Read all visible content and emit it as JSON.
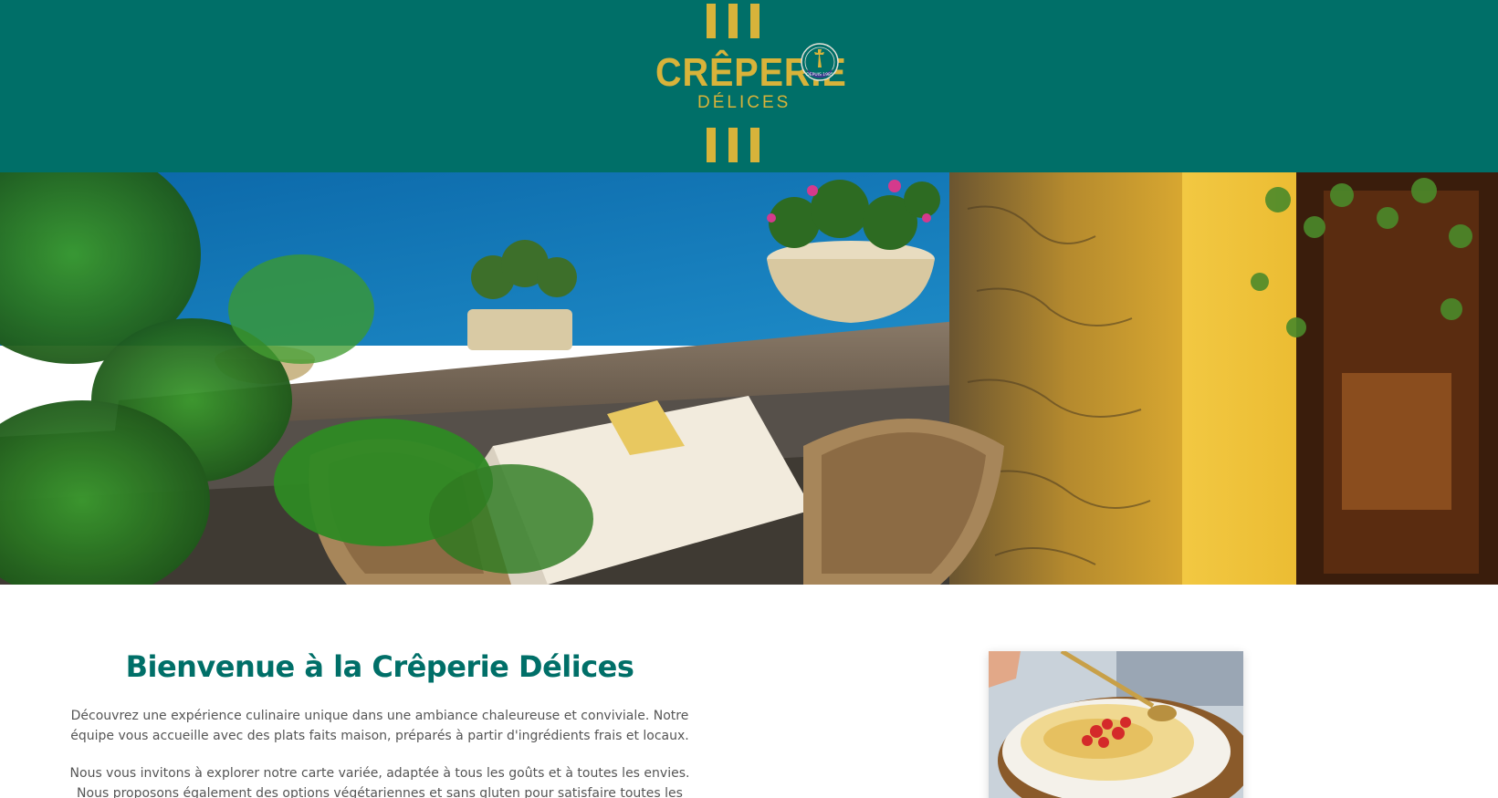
{
  "header": {
    "logo": {
      "word": "CRÊPERIE",
      "subtitle": "DÉLICES",
      "badge_text": "DEPUIS 1985"
    },
    "background_color": "#006f68",
    "accent_color": "#d8b33a"
  },
  "hero": {
    "image": "restaurant-terrace-photo"
  },
  "intro": {
    "title": "Bienvenue à la Crêperie Délices",
    "paragraphs": [
      "Découvrez une expérience culinaire unique dans une ambiance chaleureuse et conviviale. Notre équipe vous accueille avec des plats faits maison, préparés à partir d'ingrédients frais et locaux.",
      "Nous vous invitons à explorer notre carte variée, adaptée à tous les goûts et à toutes les envies. Nous proposons également des options végétariennes et sans gluten pour satisfaire toutes les préférences."
    ],
    "image": "crepe-photo"
  }
}
